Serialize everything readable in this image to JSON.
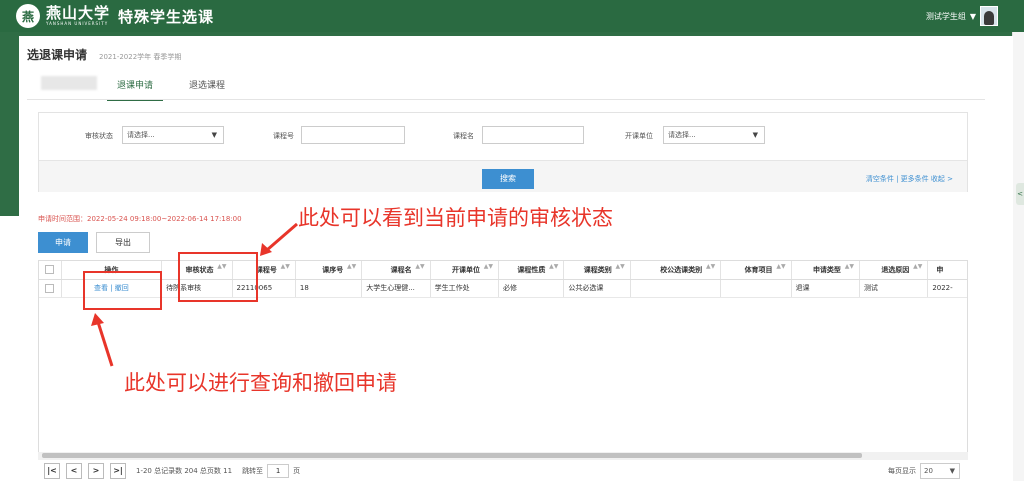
{
  "header": {
    "logo_char": "燕",
    "brand_cn": "燕山大学",
    "brand_en": "YANSHAN UNIVERSITY",
    "app_title": "特殊学生选课",
    "user_name": "测试学生组",
    "caret": "▼"
  },
  "page": {
    "title": "选退课申请",
    "term": "2021-2022学年 春季学期",
    "tabs": [
      {
        "label": "退课申请",
        "active": true
      },
      {
        "label": "退选课程",
        "active": false
      }
    ],
    "side_tab": "<"
  },
  "filter": {
    "status_label": "审核状态",
    "status_placeholder": "请选择...",
    "course_no_label": "课程号",
    "course_name_label": "课程名",
    "dept_label": "开课单位",
    "dept_placeholder": "请选择...",
    "dropdown_glyph": "▼",
    "search_button": "搜索",
    "links": "清空条件 | 更多条件   收起 >"
  },
  "toolbar": {
    "date_range": "申请时间范围：2022-05-24 09:18:00~2022-06-14 17:18:00",
    "apply_button": "申请",
    "export_button": "导出"
  },
  "table": {
    "columns": [
      "操作",
      "审核状态",
      "课程号",
      "课序号",
      "课程名",
      "开课单位",
      "课程性质",
      "课程类别",
      "校公选课类别",
      "体育项目",
      "申请类型",
      "退选原因",
      "申"
    ],
    "sort_glyph": "▲▼",
    "rows": [
      {
        "op_view": "查看",
        "op_sep": " | ",
        "op_withdraw": "撤回",
        "status": "待院系审核",
        "course_no": "22110065",
        "seq_no": "18",
        "course_name": "大学生心理健...",
        "dept": "学生工作处",
        "nature": "必修",
        "category": "公共必选课",
        "public_category": "",
        "sport": "",
        "apply_type": "退课",
        "reason": "测试",
        "apply_time": "2022-"
      }
    ]
  },
  "pager": {
    "first": "|<",
    "prev": "<",
    "next": ">",
    "last": ">|",
    "summary": "1-20 总记录数 204   总页数 11",
    "jump_label": "跳转至",
    "jump_value": "1",
    "page_unit": "页",
    "size_label": "每页显示",
    "size_value": "20",
    "size_glyph": "▼"
  },
  "annotations": {
    "status_note": "此处可以看到当前申请的审核状态",
    "op_note": "此处可以进行查询和撤回申请"
  },
  "colors": {
    "brand_green": "#2a6a41",
    "accent_blue": "#3d8fd1",
    "annotation_red": "#e8352a"
  }
}
